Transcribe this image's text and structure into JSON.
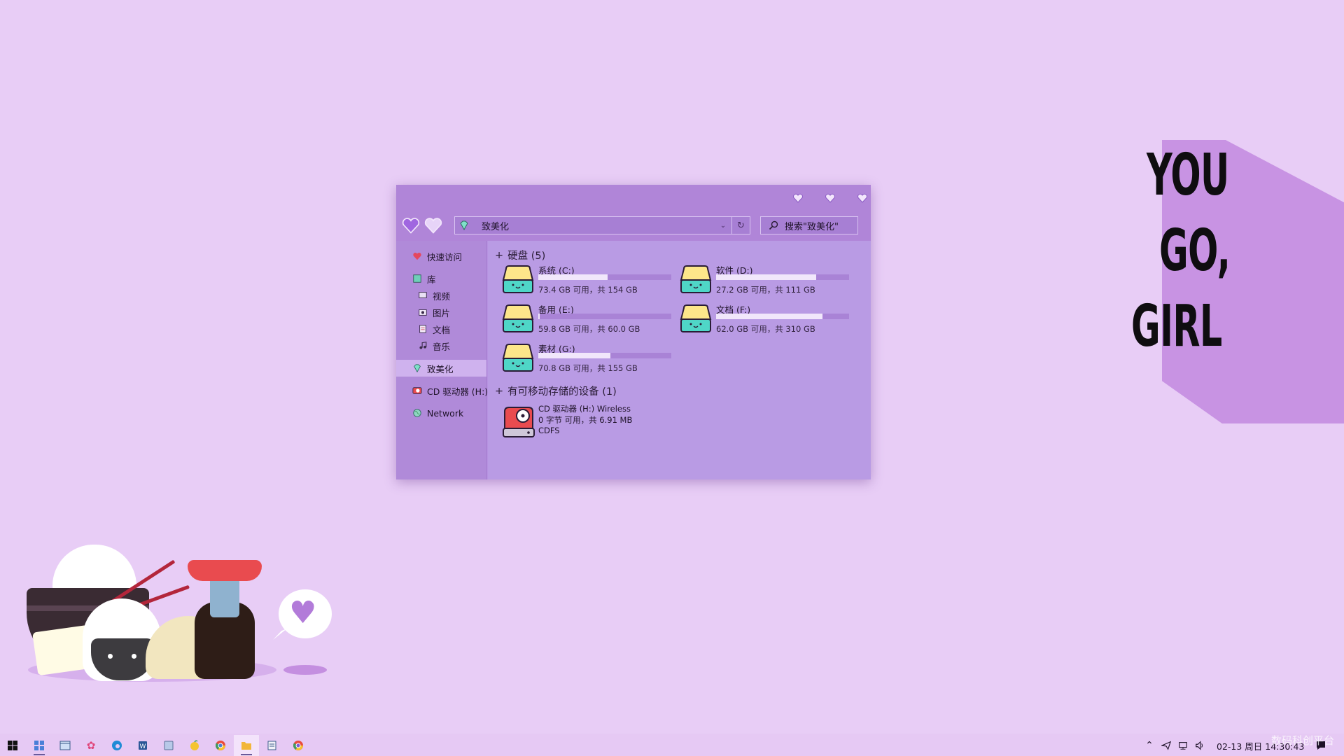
{
  "wallpaper": {
    "slogan": [
      "YOU",
      "GO,",
      "GIRL"
    ]
  },
  "explorer": {
    "address": "致美化",
    "search_placeholder": "搜索\"致美化\"",
    "sidebar": {
      "quick_access": "快速访问",
      "library": "库",
      "videos": "视频",
      "pictures": "图片",
      "documents": "文档",
      "music": "音乐",
      "zhimeihua": "致美化",
      "cd_drive": "CD 驱动器 (H:)",
      "network": "Network"
    },
    "hard_disks": {
      "header": "硬盘 (5)",
      "drives": [
        {
          "name": "系统 (C:)",
          "info": "73.4 GB 可用，共 154 GB",
          "used_fraction": 0.52
        },
        {
          "name": "软件 (D:)",
          "info": "27.2 GB 可用，共 111 GB",
          "used_fraction": 0.75
        },
        {
          "name": "备用 (E:)",
          "info": "59.8 GB 可用，共 60.0 GB",
          "used_fraction": 0.01
        },
        {
          "name": "文档 (F:)",
          "info": "62.0 GB 可用，共 310 GB",
          "used_fraction": 0.8
        },
        {
          "name": "素材 (G:)",
          "info": "70.8 GB 可用，共 155 GB",
          "used_fraction": 0.54
        }
      ]
    },
    "removable": {
      "header": "有可移动存储的设备 (1)",
      "device": {
        "name": "CD 驱动器 (H:) Wireless",
        "space": "0 字节 可用，共 6.91 MB",
        "filesystem": "CDFS"
      }
    }
  },
  "taskbar": {
    "clock": "02-13 周日 14:30:43",
    "apps": [
      "start-icon",
      "widgets-icon",
      "window-icon",
      "xiu-icon",
      "edge-icon",
      "word-icon",
      "photoshop-icon",
      "fruit-icon",
      "chrome-icon",
      "folder-icon",
      "notepad-icon",
      "chrome-alt-icon"
    ]
  },
  "watermark": "数码科创平台",
  "colors": {
    "desktop": "#e8cdf6",
    "window": "#b893e1",
    "accent": "#b085d8",
    "drive_yellow": "#fde68a",
    "drive_teal": "#4fd6c7"
  }
}
